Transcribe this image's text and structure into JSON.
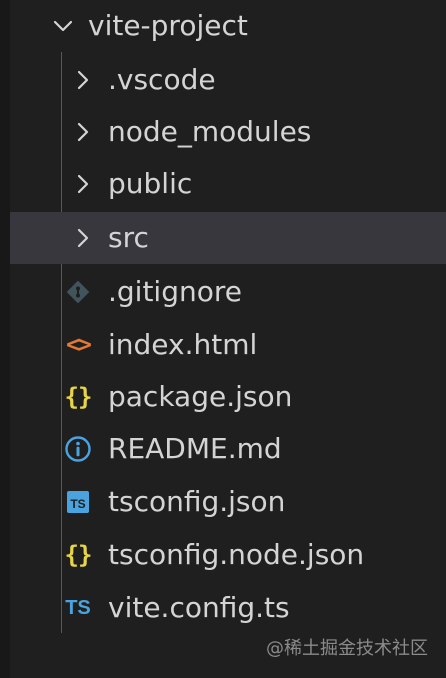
{
  "explorer": {
    "root": {
      "label": "vite-project",
      "expanded": true
    },
    "items": [
      {
        "label": ".vscode",
        "type": "folder",
        "icon": "chevron-right-icon",
        "selected": false
      },
      {
        "label": "node_modules",
        "type": "folder",
        "icon": "chevron-right-icon",
        "selected": false
      },
      {
        "label": "public",
        "type": "folder",
        "icon": "chevron-right-icon",
        "selected": false
      },
      {
        "label": "src",
        "type": "folder",
        "icon": "chevron-right-icon",
        "selected": true
      },
      {
        "label": ".gitignore",
        "type": "file",
        "icon": "git-icon",
        "selected": false
      },
      {
        "label": "index.html",
        "type": "file",
        "icon": "html-icon",
        "selected": false
      },
      {
        "label": "package.json",
        "type": "file",
        "icon": "json-icon",
        "selected": false
      },
      {
        "label": "README.md",
        "type": "file",
        "icon": "info-icon",
        "selected": false
      },
      {
        "label": "tsconfig.json",
        "type": "file",
        "icon": "tsconfig-icon",
        "selected": false
      },
      {
        "label": "tsconfig.node.json",
        "type": "file",
        "icon": "json-icon",
        "selected": false
      },
      {
        "label": "vite.config.ts",
        "type": "file",
        "icon": "typescript-icon",
        "selected": false
      }
    ]
  },
  "icons": {
    "html": "<>",
    "json": "{}",
    "ts": "TS"
  },
  "colors": {
    "background": "#1f1f1f",
    "selected": "#37373d",
    "text": "#d4d4d4",
    "json": "#e6d44a",
    "html": "#e37933",
    "info": "#4aa3df",
    "ts": "#4aa3df",
    "git": "#41535b"
  },
  "watermark": "@稀土掘金技术社区"
}
